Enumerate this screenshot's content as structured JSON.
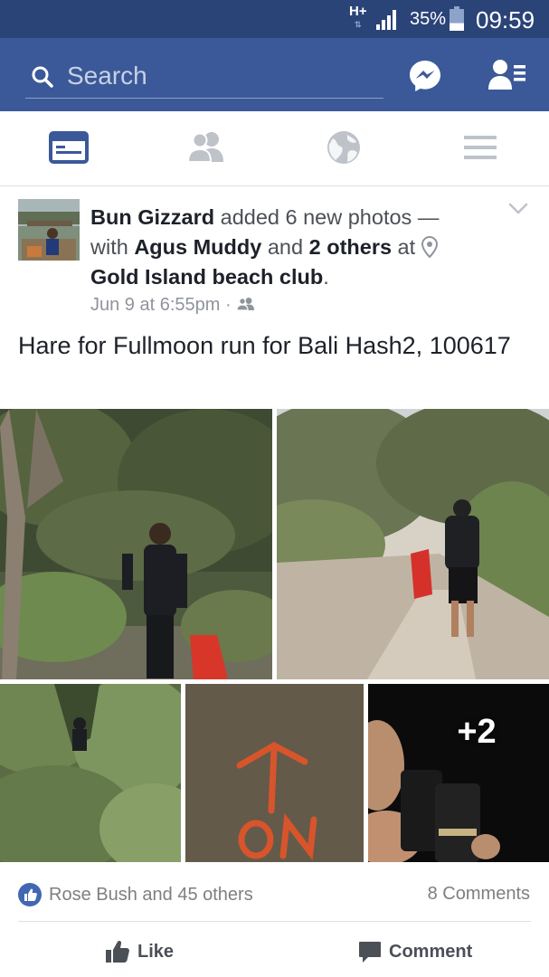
{
  "status_bar": {
    "network": "H+",
    "network_sub": "⇅",
    "battery_percent": "35%",
    "battery_level": 0.35,
    "time": "09:59"
  },
  "header": {
    "search_placeholder": "Search",
    "icons": [
      "search-icon",
      "messenger-icon",
      "friend-requests-icon"
    ]
  },
  "nav_tabs": [
    {
      "name": "news-feed",
      "icon": "news-feed-icon",
      "active": true
    },
    {
      "name": "friends",
      "icon": "friends-icon",
      "active": false
    },
    {
      "name": "notifications",
      "icon": "globe-icon",
      "active": false
    },
    {
      "name": "menu",
      "icon": "menu-icon",
      "active": false
    }
  ],
  "post": {
    "author": "Bun Gizzard",
    "action_text": " added 6 new photos — with ",
    "tagged_person": "Agus Muddy",
    "and_text": " and ",
    "others_text": "2 others",
    "at_text": " at ",
    "location": "Gold Island beach club",
    "period": ".",
    "timestamp": "Jun 9 at 6:55pm",
    "privacy_separator": " · ",
    "caption": "Hare for Fullmoon run for Bali Hash2, 100617",
    "more_photos": "+2",
    "reactions_text": "Rose Bush and 45 others",
    "comments_count": "8 Comments",
    "like_label": "Like",
    "comment_label": "Comment"
  },
  "colors": {
    "status_bar": "#2b4478",
    "header": "#3b5998",
    "active_tab": "#3b5998",
    "inactive_tab": "#bec2c9",
    "like_blue": "#4267b2"
  }
}
